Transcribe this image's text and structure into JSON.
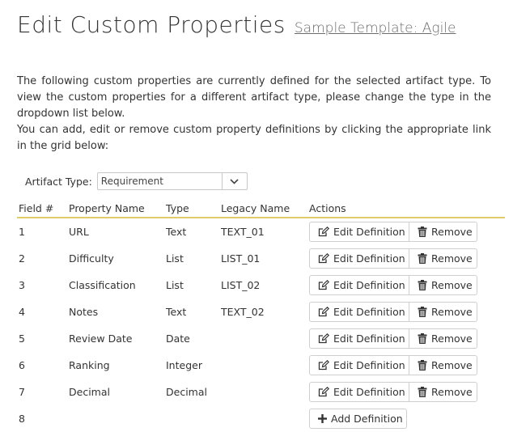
{
  "header": {
    "title": "Edit Custom Properties",
    "template_link": "Sample Template: Agile"
  },
  "intro": {
    "paragraph1": "The following custom properties are currently defined for the selected artifact type. To view the custom properties for a different artifact type, please change the type in the dropdown list below.",
    "paragraph2": "You can add, edit or remove custom property definitions by clicking the appropriate link in the grid below:"
  },
  "filter": {
    "label": "Artifact Type:",
    "selected": "Requirement",
    "icon": "chevron-down-icon"
  },
  "grid": {
    "headers": [
      "Field #",
      "Property Name",
      "Type",
      "Legacy Name",
      "Actions"
    ],
    "rows": [
      {
        "field": "1",
        "name": "URL",
        "type": "Text",
        "legacy": "TEXT_01"
      },
      {
        "field": "2",
        "name": "Difficulty",
        "type": "List",
        "legacy": "LIST_01"
      },
      {
        "field": "3",
        "name": "Classification",
        "type": "List",
        "legacy": "LIST_02"
      },
      {
        "field": "4",
        "name": "Notes",
        "type": "Text",
        "legacy": "TEXT_02"
      },
      {
        "field": "5",
        "name": "Review Date",
        "type": "Date",
        "legacy": ""
      },
      {
        "field": "6",
        "name": "Ranking",
        "type": "Integer",
        "legacy": ""
      },
      {
        "field": "7",
        "name": "Decimal",
        "type": "Decimal",
        "legacy": ""
      }
    ],
    "add_row": {
      "field": "8"
    },
    "edit_label": "Edit Definition",
    "remove_label": "Remove",
    "add_label": "Add Definition",
    "header_border_color": "#e2cc6a"
  }
}
